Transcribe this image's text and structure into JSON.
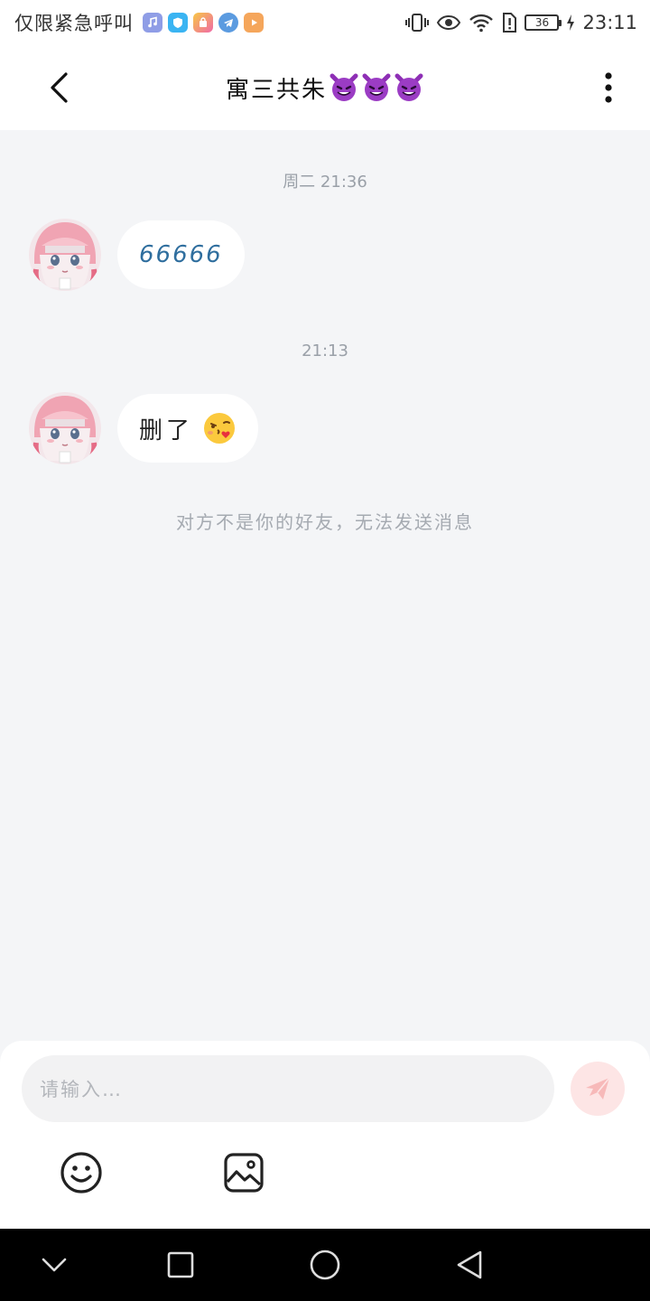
{
  "status_bar": {
    "carrier": "仅限紧急呼叫",
    "battery": "36",
    "time": "23:11",
    "app_icons": [
      {
        "name": "music-app-icon",
        "color": "#7b8ce6"
      },
      {
        "name": "shield-app-icon",
        "color": "#3ab4f2"
      },
      {
        "name": "store-app-icon",
        "color": "#f2a03a"
      },
      {
        "name": "telegram-app-icon",
        "color": "#5b9be0"
      },
      {
        "name": "video-app-icon",
        "color": "#f5a65b"
      }
    ]
  },
  "header": {
    "title": "寓三共朱",
    "title_emoji": "smiling-devil"
  },
  "chat": {
    "messages": [
      {
        "time": "周二 21:36",
        "text": "66666"
      },
      {
        "time": "21:13",
        "text": "删了",
        "emoji": "kissing-face"
      }
    ],
    "notice": "对方不是你的好友，无法发送消息"
  },
  "input": {
    "placeholder": "请输入…"
  },
  "colors": {
    "background": "#f4f5f7",
    "bubble_text_blue": "#2f6e9e",
    "send_button_bg": "#fde5e5",
    "send_button_icon": "#f7b9b9"
  }
}
